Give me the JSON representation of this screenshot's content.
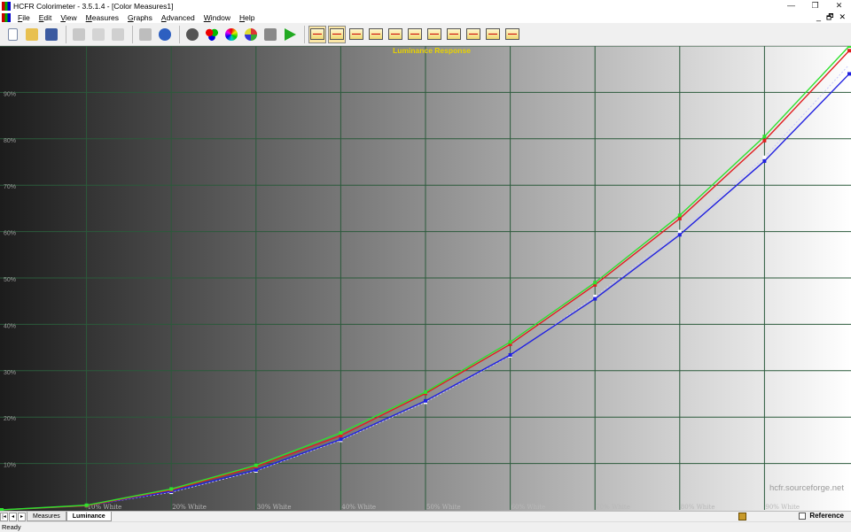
{
  "window": {
    "title": "HCFR Colorimeter - 3.5.1.4 - [Color Measures1]"
  },
  "window_buttons": {
    "minimize": "—",
    "restore": "❐",
    "close": "✕"
  },
  "mdi_buttons": {
    "minimize": "_",
    "restore": "🗗",
    "close": "✕"
  },
  "menu": [
    "File",
    "Edit",
    "View",
    "Measures",
    "Graphs",
    "Advanced",
    "Window",
    "Help"
  ],
  "toolbar": {
    "icons": [
      "new-file-icon",
      "open-folder-icon",
      "save-icon",
      "cut-icon",
      "copy-icon",
      "paste-icon",
      "print-icon",
      "help-icon",
      "sensor-icon",
      "rgb-icon",
      "color-picker-icon",
      "patterns-icon",
      "camera-icon",
      "play-icon"
    ],
    "graph_icons": [
      "luminance-graph-icon",
      "gamma-graph-icon",
      "rgb-levels-graph-icon",
      "color-temp-graph-icon",
      "cie-chart-icon",
      "saturation-graph-icon",
      "near-black-graph-icon",
      "near-white-graph-icon",
      "color-checker-graph-icon",
      "delta-e-graph-icon",
      "free-measures-graph-icon"
    ]
  },
  "tabs": [
    "Measures",
    "Luminance"
  ],
  "active_tab": "Luminance",
  "reference_label": "Reference",
  "status": "Ready",
  "watermark": "hcfr.sourceforge.net",
  "chart_data": {
    "type": "line",
    "title": "Luminance Response",
    "x": [
      0,
      10,
      20,
      30,
      40,
      50,
      60,
      70,
      80,
      90,
      100
    ],
    "x_tick_labels": [
      "",
      "10% White",
      "20% White",
      "30% White",
      "40% White",
      "50% White",
      "60% White",
      "70% White",
      "80% White",
      "90% White",
      ""
    ],
    "y_tick_labels": [
      "10%",
      "20%",
      "30%",
      "40%",
      "50%",
      "60%",
      "70%",
      "80%",
      "90%"
    ],
    "ylim": [
      0,
      100
    ],
    "xlim": [
      0,
      100
    ],
    "grid": true,
    "series": [
      {
        "color": "#2fe02f",
        "values": [
          0,
          1.0,
          4.5,
          9.6,
          16.6,
          25.4,
          36.2,
          49.0,
          63.5,
          80.5,
          100
        ]
      },
      {
        "color": "#e02020",
        "values": [
          0,
          0.9,
          4.3,
          9.3,
          16.0,
          25.1,
          35.7,
          48.5,
          62.8,
          79.6,
          99
        ]
      },
      {
        "color": "#2020e0",
        "values": [
          0,
          0.9,
          4.0,
          8.6,
          15.2,
          23.5,
          33.4,
          45.5,
          59.3,
          75.2,
          94
        ]
      },
      {
        "color": "#c8c8ff",
        "values": [
          0,
          0.9,
          3.8,
          8.4,
          15.0,
          23.2,
          33.2,
          46.0,
          60.0,
          76.0,
          96
        ]
      }
    ]
  }
}
